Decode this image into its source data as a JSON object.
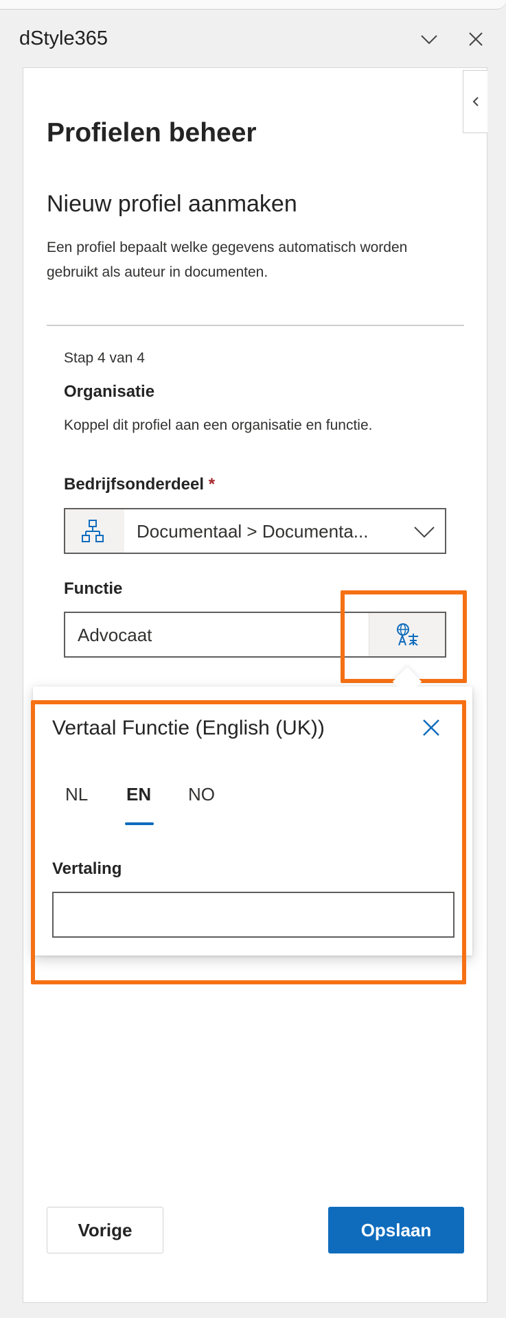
{
  "app": {
    "title": "dStyle365"
  },
  "page": {
    "title": "Profielen beheer",
    "subtitle": "Nieuw profiel aanmaken",
    "description": "Een profiel bepaalt welke gegevens automatisch worden gebruikt als auteur in documenten."
  },
  "step": {
    "indicator": "Stap 4 van 4",
    "title": "Organisatie",
    "description": "Koppel dit profiel aan een organisatie en functie."
  },
  "form": {
    "department": {
      "label": "Bedrijfsonderdeel",
      "required_mark": "*",
      "value": "Documentaal > Documenta..."
    },
    "function": {
      "label": "Functie",
      "value": "Advocaat"
    }
  },
  "translation_callout": {
    "title": "Vertaal Functie (English (UK))",
    "tabs": [
      {
        "label": "NL"
      },
      {
        "label": "EN"
      },
      {
        "label": "NO"
      }
    ],
    "active_tab": "EN",
    "field_label": "Vertaling",
    "field_value": ""
  },
  "footer": {
    "prev_label": "Vorige",
    "save_label": "Opslaan"
  },
  "colors": {
    "accent": "#0f6cbd",
    "highlight": "#f57114",
    "required": "#a4262c"
  },
  "icons": {
    "titlebar": [
      "chevron-down-icon",
      "close-icon"
    ],
    "panel": [
      "chevron-left-icon"
    ],
    "department": "org-chart-icon",
    "translate": "translate-icon",
    "callout_close": "close-icon"
  }
}
